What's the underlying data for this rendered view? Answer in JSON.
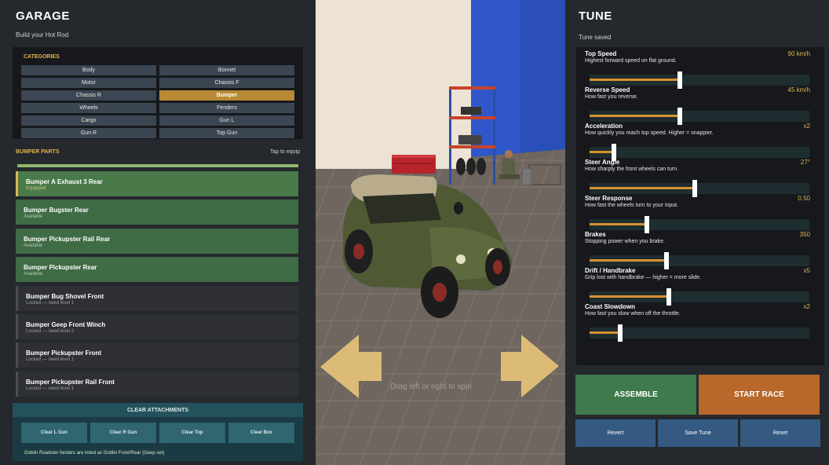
{
  "left": {
    "title": "GARAGE",
    "subtitle": "Build your Hot Rod",
    "categories_heading": "CATEGORIES",
    "categories": [
      {
        "label": "Body"
      },
      {
        "label": "Bonnet"
      },
      {
        "label": "Motor"
      },
      {
        "label": "Chassis F"
      },
      {
        "label": "Chassis R"
      },
      {
        "label": "Bumper"
      },
      {
        "label": "Wheels"
      },
      {
        "label": "Fenders"
      },
      {
        "label": "Cargo"
      },
      {
        "label": "Gun L"
      },
      {
        "label": "Gun R"
      },
      {
        "label": "Top Gun"
      }
    ],
    "selected_category": "Bumper",
    "parts_heading": "BUMPER PARTS",
    "tap_hint": "Tap to equip",
    "parts": [
      {
        "name": "Bumper A Exhaust 3 Rear",
        "status": "Equipped"
      },
      {
        "name": "Bumper Bugster Rear",
        "status": "Available"
      },
      {
        "name": "Bumper Pickupster Rail Rear",
        "status": "Available"
      },
      {
        "name": "Bumper Pickupster Rear",
        "status": "Available"
      },
      {
        "name": "Bumper Bug Shovel Front",
        "status": "Locked — need level 1"
      },
      {
        "name": "Bumper Geep Front Winch",
        "status": "Locked — need level 2"
      },
      {
        "name": "Bumper Pickupster Front",
        "status": "Locked — need level 1"
      },
      {
        "name": "Bumper Pickupster Rail Front",
        "status": "Locked — need level 1"
      }
    ],
    "clear_all": "CLEAR ATTACHMENTS",
    "clear_buttons": [
      {
        "label": "Clear L Gun"
      },
      {
        "label": "Clear R Gun"
      },
      {
        "label": "Clear Top"
      },
      {
        "label": "Clear Box"
      }
    ],
    "note": "Goblin Roadster fenders are listed as Goblin Front/Rear (Geep set)"
  },
  "viewport": {
    "drag_hint": "Drag left or right to spin"
  },
  "right": {
    "title": "TUNE",
    "status": "Tune saved",
    "settings": [
      {
        "name": "Top Speed",
        "value": "90 km/h",
        "desc": "Highest forward speed on flat ground.",
        "level": 0.41
      },
      {
        "name": "Reverse Speed",
        "value": "45 km/h",
        "desc": "How fast you reverse.",
        "level": 0.41
      },
      {
        "name": "Acceleration",
        "value": "x2",
        "desc": "How quickly you reach top speed. Higher = snappier.",
        "level": 0.11
      },
      {
        "name": "Steer Angle",
        "value": "27°",
        "desc": "How sharply the front wheels can turn.",
        "level": 0.48
      },
      {
        "name": "Steer Response",
        "value": "0.50",
        "desc": "How fast the wheels turn to your input.",
        "level": 0.26
      },
      {
        "name": "Brakes",
        "value": "350",
        "desc": "Stopping power when you brake.",
        "level": 0.35
      },
      {
        "name": "Drift / Handbrake",
        "value": "x5",
        "desc": "Grip lost with handbrake — higher = more slide.",
        "level": 0.36
      },
      {
        "name": "Coast Slowdown",
        "value": "x2",
        "desc": "How fast you slow when off the throttle.",
        "level": 0.14
      }
    ],
    "assemble": "ASSEMBLE",
    "start_race": "START RACE",
    "revert": "Revert",
    "save_tune": "Save Tune",
    "reset": "Reset"
  },
  "colors": {
    "accent": "#e3b550",
    "assemble": "#3f7a4d",
    "start_race": "#b8682a",
    "secondary_button": "#345a82",
    "slider_fill": "#d7912e"
  }
}
